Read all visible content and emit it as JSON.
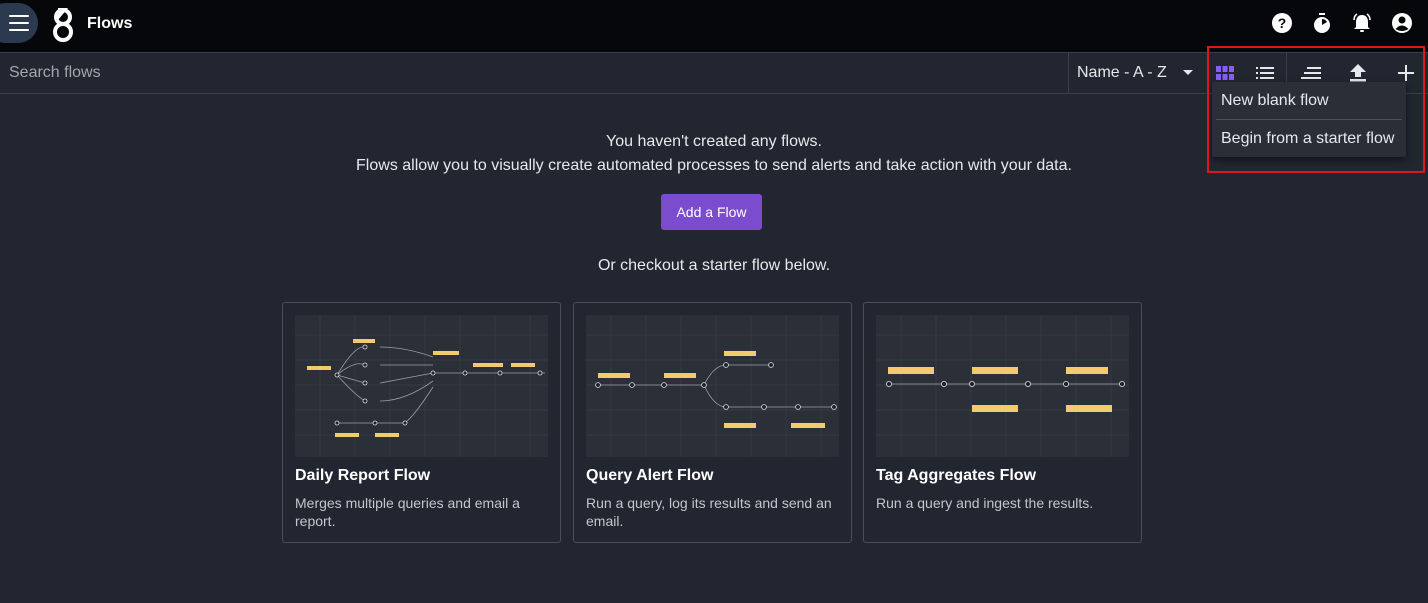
{
  "header": {
    "title": "Flows",
    "icons": [
      "menu-icon",
      "app-logo-icon",
      "help-icon",
      "timer-icon",
      "alerts-bell-icon",
      "account-icon"
    ]
  },
  "toolbar": {
    "search_placeholder": "Search flows",
    "sort_value": "Name - A - Z",
    "view_grid_icon": "grid-view-icon",
    "view_list_icon": "list-view-icon",
    "active_view_color": "#8a5cf6"
  },
  "add_menu": {
    "items": [
      "New blank flow",
      "Begin from a starter flow"
    ]
  },
  "empty_state": {
    "line1": "You haven't created any flows.",
    "line2": "Flows allow you to visually create automated processes to send alerts and take action with your data.",
    "add_button": "Add a Flow",
    "starter_prompt": "Or checkout a starter flow below."
  },
  "starter_flows": [
    {
      "title": "Daily Report Flow",
      "description": "Merges multiple queries and email a report."
    },
    {
      "title": "Query Alert Flow",
      "description": "Run a query, log its results and send an email."
    },
    {
      "title": "Tag Aggregates Flow",
      "description": "Run a query and ingest the results."
    }
  ],
  "colors": {
    "accent": "#7c4ccf",
    "highlight": "#e0161d",
    "background": "#222630",
    "topbar": "#05070a"
  }
}
